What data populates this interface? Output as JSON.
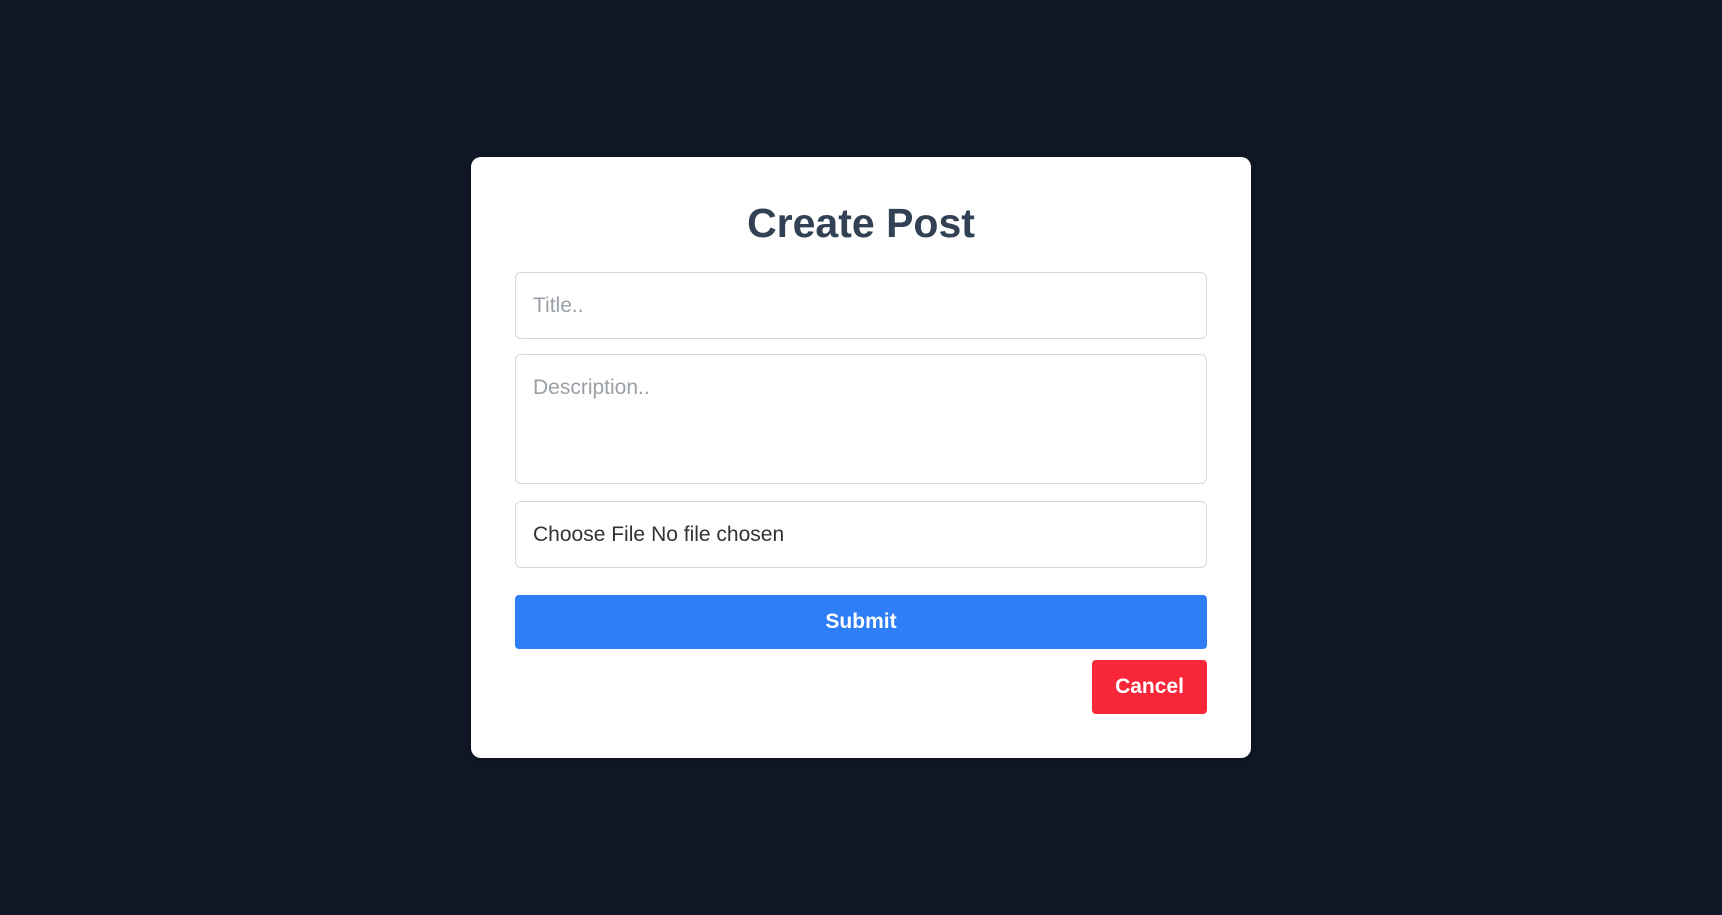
{
  "form": {
    "heading": "Create Post",
    "title_placeholder": "Title..",
    "title_value": "",
    "description_placeholder": "Description..",
    "description_value": "",
    "file_button_label": "Choose File",
    "file_status": "No file chosen",
    "submit_label": "Submit",
    "cancel_label": "Cancel"
  },
  "colors": {
    "background": "#111827",
    "card": "#ffffff",
    "heading": "#334155",
    "submit": "#2d7ef7",
    "cancel": "#f8283a"
  }
}
